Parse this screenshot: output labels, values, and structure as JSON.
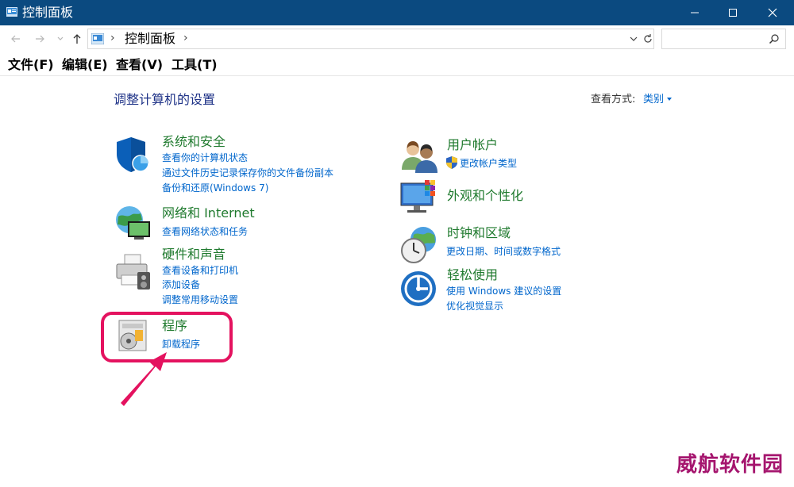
{
  "window": {
    "title": "控制面板"
  },
  "address": {
    "breadcrumb": "控制面板",
    "search_placeholder": ""
  },
  "menu": {
    "items": [
      "文件(F)",
      "编辑(E)",
      "查看(V)",
      "工具(T)"
    ]
  },
  "content": {
    "heading": "调整计算机的设置",
    "view_by_label": "查看方式:",
    "view_by_value": "类别"
  },
  "categories": {
    "security": {
      "title": "系统和安全",
      "links": [
        "查看你的计算机状态",
        "通过文件历史记录保存你的文件备份副本",
        "备份和还原(Windows 7)"
      ]
    },
    "network": {
      "title": "网络和 Internet",
      "links": [
        "查看网络状态和任务"
      ]
    },
    "hardware": {
      "title": "硬件和声音",
      "links": [
        "查看设备和打印机",
        "添加设备",
        "调整常用移动设置"
      ]
    },
    "programs": {
      "title": "程序",
      "links": [
        "卸载程序"
      ]
    },
    "accounts": {
      "title": "用户帐户",
      "links": [
        "更改帐户类型"
      ]
    },
    "appearance": {
      "title": "外观和个性化",
      "links": []
    },
    "clock": {
      "title": "时钟和区域",
      "links": [
        "更改日期、时间或数字格式"
      ]
    },
    "ease": {
      "title": "轻松使用",
      "links": [
        "使用 Windows 建议的设置",
        "优化视觉显示"
      ]
    }
  },
  "watermark": "威航软件园",
  "colors": {
    "titlebar": "#0b4a80",
    "category_title": "#1f7a2e",
    "link": "#0066cc",
    "heading": "#1e3287",
    "highlight": "#e4125f"
  }
}
